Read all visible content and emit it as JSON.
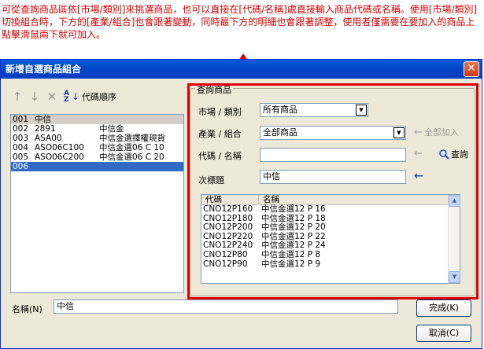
{
  "instructions": "可從查詢商品區依[市場/類別]來挑選商品，也可以直接在[代碼/名稱]處直接輸入商品代碼或名稱。使用[市場/類別]切換組合時，下方的[產業/組合]也會跟著變動，同時最下方的明細也會跟著調整，使用者僅需要在要加入的商品上點擊滑鼠兩下就可加入。",
  "dialog": {
    "title": "新增自選商品組合",
    "close_label": "✕"
  },
  "toolbar": {
    "sort_label": "代碼順序"
  },
  "left_list": {
    "rows": [
      {
        "no": "001",
        "code": "中信",
        "name": ""
      },
      {
        "no": "002",
        "code": "2891",
        "name": "中信金"
      },
      {
        "no": "003",
        "code": "ASA00",
        "name": "中信金選擇權現貨"
      },
      {
        "no": "004",
        "code": "ASO06C100",
        "name": "中信金選06 C 10"
      },
      {
        "no": "005",
        "code": "ASO06C200",
        "name": "中信金選06 C 20"
      },
      {
        "no": "006",
        "code": "",
        "name": ""
      }
    ]
  },
  "search": {
    "group_title": "查詢商品",
    "market_label": "市場 / 類別",
    "market_value": "所有商品",
    "industry_label": "產業 / 組合",
    "industry_value": "全部商品",
    "add_all_label": "全部加入",
    "code_label": "代碼 / 名稱",
    "code_value": "",
    "query_label": "查詢",
    "subtitle_label": "次標題",
    "subtitle_value": "中信"
  },
  "results": {
    "headers": {
      "code": "代碼",
      "name": "名稱"
    },
    "rows": [
      {
        "code": "CNO12P160",
        "name": "中信金選12 P 16"
      },
      {
        "code": "CNO12P180",
        "name": "中信金選12 P 18"
      },
      {
        "code": "CNO12P200",
        "name": "中信金選12 P 20"
      },
      {
        "code": "CNO12P220",
        "name": "中信金選12 P 22"
      },
      {
        "code": "CNO12P240",
        "name": "中信金選12 P 24"
      },
      {
        "code": "CNO12P80",
        "name": "中信金選12 P 8"
      },
      {
        "code": "CNO12P90",
        "name": "中信金選12 P 9"
      }
    ]
  },
  "footer": {
    "name_label": "名稱(N)",
    "name_value": "中信",
    "finish_label": "完成(K)",
    "cancel_label": "取消(C)"
  }
}
